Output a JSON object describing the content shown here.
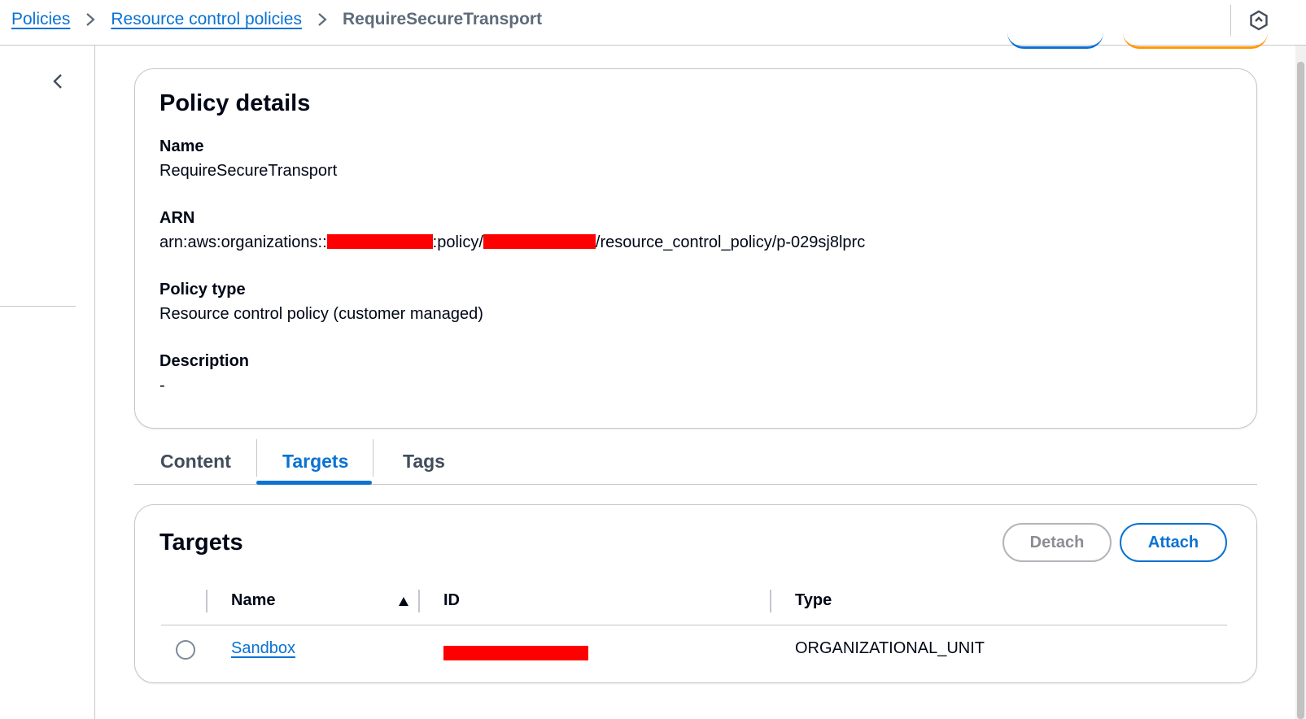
{
  "breadcrumb": {
    "items": [
      {
        "label": "Policies"
      },
      {
        "label": "Resource control policies"
      },
      {
        "label": "RequireSecureTransport"
      }
    ]
  },
  "policy_details": {
    "title": "Policy details",
    "name_label": "Name",
    "name_value": "RequireSecureTransport",
    "arn_label": "ARN",
    "arn_prefix": "arn:aws:organizations::",
    "arn_mid": ":policy/",
    "arn_suffix": "/resource_control_policy/p-029sj8lprc",
    "type_label": "Policy type",
    "type_value": "Resource control policy (customer managed)",
    "description_label": "Description",
    "description_value": "-"
  },
  "tabs": [
    {
      "label": "Content",
      "active": false
    },
    {
      "label": "Targets",
      "active": true
    },
    {
      "label": "Tags",
      "active": false
    }
  ],
  "targets": {
    "title": "Targets",
    "detach_label": "Detach",
    "attach_label": "Attach",
    "columns": {
      "name": "Name",
      "id": "ID",
      "type": "Type"
    },
    "rows": [
      {
        "name": "Sandbox",
        "type": "ORGANIZATIONAL_UNIT"
      }
    ]
  },
  "icons": {
    "breadcrumb_separator": "chevron-right-icon",
    "nav_toggle": "chevron-left-icon",
    "top_right": "hexagon-icon",
    "sort": "sort-ascending-icon"
  },
  "colors": {
    "link": "#0972d3",
    "border": "#c6c6cd",
    "redaction": "#ff0000",
    "primary_accent": "#ff9900"
  }
}
